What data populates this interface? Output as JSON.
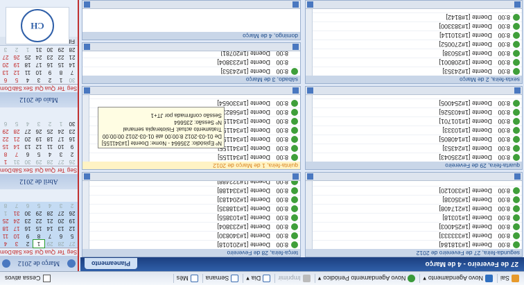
{
  "toolbar": {
    "items": [
      {
        "label": "Sai",
        "icon": "exit-icon"
      },
      {
        "label": "Novo Agendamento",
        "icon": "calendar-add-icon"
      },
      {
        "label": "Novo Agendamento Periódico",
        "icon": "recurring-add-icon"
      },
      {
        "label": "Imprimir",
        "icon": "print-icon",
        "disabled": true
      },
      {
        "label": "Dia",
        "icon": "day-view-icon"
      },
      {
        "label": "Semana",
        "icon": "week-view-icon"
      },
      {
        "label": "Mês",
        "icon": "month-view-icon"
      }
    ],
    "checkbox_label": "Cessa ativos"
  },
  "header": {
    "range": "27 de Fevereiro - 4 de Março",
    "tab": "Planeamento"
  },
  "days": [
    {
      "title": "segunda-feira, 27 de Fevereiro de 2012",
      "appointments": [
        {
          "time": "8:00",
          "text": "Doente [1#318184]"
        },
        {
          "time": "8:00",
          "text": "Doente [1#333333]"
        },
        {
          "time": "8:00",
          "text": "Doente [1#254003]"
        },
        {
          "time": "8:00",
          "text": "Doente [1#10318]"
        },
        {
          "time": "8:00",
          "text": "Doente [1#217408]"
        },
        {
          "time": "8:00",
          "text": "Doente [1#35038]"
        },
        {
          "time": "8:00",
          "text": "Doente [1#330120]"
        }
      ]
    },
    {
      "title": "terça-feira, 28 de Fevereiro",
      "appointments": [
        {
          "time": "8:00",
          "text": "Doente [1#201018]"
        },
        {
          "time": "8:00",
          "text": "Doente [1#340830]"
        },
        {
          "time": "8:00",
          "text": "Doente [1#233804]"
        },
        {
          "time": "8:00",
          "text": "Doente [1#103855]"
        },
        {
          "time": "8:00",
          "text": "Doente [1#318835]"
        },
        {
          "time": "8:00",
          "text": "Doente [1#204183]"
        },
        {
          "time": "8:00",
          "text": "Doente [1#334188]"
        },
        {
          "time": "8:00",
          "text": "Doente [1#322488]"
        }
      ]
    },
    {
      "title": "quarta-feira, 29 de Fevereiro",
      "appointments": [
        {
          "time": "8:00",
          "text": "Doente [1#235043]"
        },
        {
          "time": "8:00",
          "text": "Doente [1#24353]"
        },
        {
          "time": "8:00",
          "text": "Doente [1#140805]"
        },
        {
          "time": "8:00",
          "text": "Doente [1#10333]"
        },
        {
          "time": "8:00",
          "text": "Doente [1#101701]"
        },
        {
          "time": "8:00",
          "text": "Doente [1#403526]"
        },
        {
          "time": "8:00",
          "text": "Doente [1#254005]"
        }
      ]
    },
    {
      "title": "quinta-feira, 1 de Março de 2012",
      "appointments": [
        {
          "time": "8:00",
          "text": "Doente [1#341155]"
        },
        {
          "time": "8:00",
          "text": "Doente [1#341155]"
        },
        {
          "time": "8:00",
          "text": "Doente [1#341155]"
        },
        {
          "time": "8:00",
          "text": "Doente [1#341155]"
        },
        {
          "time": "8:00",
          "text": "Doente [1#341155]"
        },
        {
          "time": "8:00",
          "text": "Doente [1#568233]"
        },
        {
          "time": "8:00",
          "text": "Doente [1#330654]"
        }
      ]
    },
    {
      "title": "sexta-feira, 2 de Março",
      "appointments": [
        {
          "time": "8:00",
          "text": "Doente [1#24353]"
        },
        {
          "time": "8:00",
          "text": "Doente [1#208001]"
        },
        {
          "time": "8:00",
          "text": "Doente [1#35038]"
        },
        {
          "time": "8:00",
          "text": "Doente [1#270052]"
        },
        {
          "time": "8:00",
          "text": "Doente [1#310114]"
        },
        {
          "time": "8:00",
          "text": "Doente [1#383300]"
        },
        {
          "time": "8:00",
          "text": "Doente [1#8142]"
        }
      ]
    },
    {
      "title": "sábado, 3 de Março",
      "appointments": [
        {
          "time": "8:00",
          "text": "Doente [1#24353]"
        },
        {
          "time": "8:00",
          "text": "Doente [1#233804]"
        },
        {
          "time": "8:00",
          "text": "Doente [1#20781]"
        }
      ]
    }
  ],
  "sunday_title": "domingo, 4 de Março",
  "tooltip": {
    "line1": "Nº Episódio: 235664 - Nome: Doente [1#341155]",
    "line2": "De 01-03-2012 8:00:00 até 01-03-2012 00:00:00",
    "line3": "Tratamento actual: Fisioterapia semanal",
    "line4": "Nº Sessão: 235664",
    "line5": "Sessão confirmada por JT+1"
  },
  "mini_calendars": [
    {
      "month": "Março de 2012",
      "dow": [
        "Seg",
        "Ter",
        "Qua",
        "Qui",
        "Sex",
        "Sáb",
        "Dom"
      ],
      "weeks": [
        [
          "27",
          "28",
          "29",
          "1",
          "2",
          "3",
          "4"
        ],
        [
          "5",
          "6",
          "7",
          "8",
          "9",
          "10",
          "11"
        ],
        [
          "12",
          "13",
          "14",
          "15",
          "16",
          "17",
          "18"
        ],
        [
          "19",
          "20",
          "21",
          "22",
          "23",
          "24",
          "25"
        ],
        [
          "26",
          "27",
          "28",
          "29",
          "30",
          "31",
          "1"
        ],
        [
          "2",
          "3",
          "4",
          "5",
          "6",
          "7",
          "8"
        ]
      ]
    },
    {
      "month": "Abril de 2012",
      "dow": [
        "Seg",
        "Ter",
        "Qua",
        "Qui",
        "Sex",
        "Sáb",
        "Dom"
      ],
      "weeks": [
        [
          "26",
          "27",
          "28",
          "29",
          "30",
          "31",
          "1"
        ],
        [
          "2",
          "3",
          "4",
          "5",
          "6",
          "7",
          "8"
        ],
        [
          "9",
          "10",
          "11",
          "12",
          "13",
          "14",
          "15"
        ],
        [
          "16",
          "17",
          "18",
          "19",
          "20",
          "21",
          "22"
        ],
        [
          "23",
          "24",
          "25",
          "26",
          "27",
          "28",
          "29"
        ],
        [
          "30",
          "1",
          "2",
          "3",
          "4",
          "5",
          "6"
        ]
      ]
    },
    {
      "month": "Maio de 2012",
      "dow": [
        "Seg",
        "Ter",
        "Qua",
        "Qui",
        "Sex",
        "Sáb",
        "Dom"
      ],
      "weeks": [
        [
          "30",
          "1",
          "2",
          "3",
          "4",
          "5",
          "6"
        ],
        [
          "7",
          "8",
          "9",
          "10",
          "11",
          "12",
          "13"
        ],
        [
          "14",
          "15",
          "16",
          "17",
          "18",
          "19",
          "20"
        ],
        [
          "21",
          "22",
          "23",
          "24",
          "25",
          "26",
          "27"
        ],
        [
          "28",
          "29",
          "30",
          "31",
          "1",
          "2",
          "3"
        ]
      ]
    }
  ],
  "filters_label": "Filtros",
  "logo_text": "CH"
}
